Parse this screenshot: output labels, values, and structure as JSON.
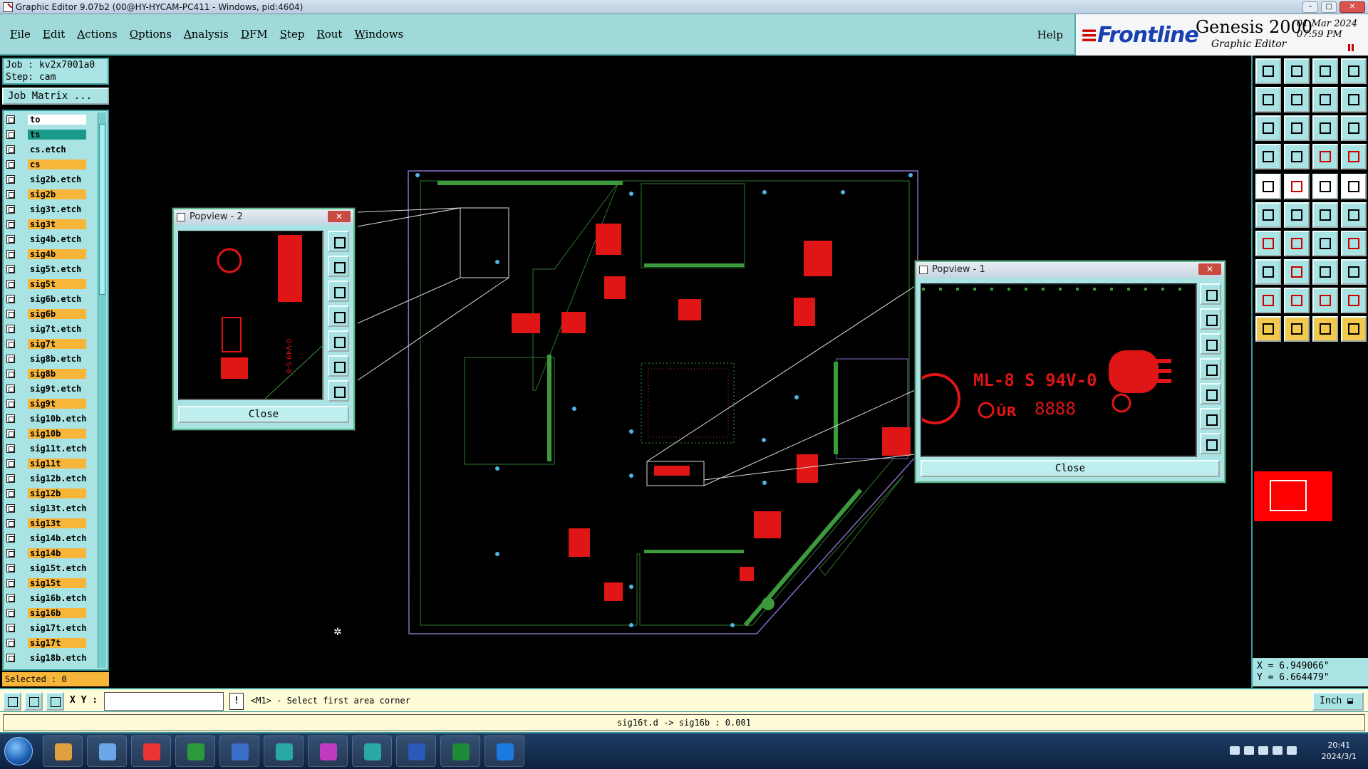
{
  "window": {
    "title": "Graphic Editor 9.07b2 (00@HY-HYCAM-PC411 - Windows, pid:4604)"
  },
  "menu": {
    "items": [
      "File",
      "Edit",
      "Actions",
      "Options",
      "Analysis",
      "DFM",
      "Step",
      "Rout",
      "Windows"
    ],
    "help": "Help"
  },
  "brand": {
    "logo": "Frontline",
    "product": "Genesis 2000",
    "subtitle": "Graphic Editor",
    "date": "01 Mar 2024",
    "time": "07:59 PM"
  },
  "job": {
    "job_line": "Job : kv2x7001a0",
    "step_line": "Step: cam",
    "matrix_button": "Job Matrix ..."
  },
  "layers": [
    {
      "name": "to",
      "color": "#ffffff"
    },
    {
      "name": "ts",
      "color": "#1a9a8a"
    },
    {
      "name": "cs.etch",
      "color": "#a9e3e3"
    },
    {
      "name": "cs",
      "color": "#f7b53a"
    },
    {
      "name": "sig2b.etch",
      "color": "#a9e3e3"
    },
    {
      "name": "sig2b",
      "color": "#f7b53a"
    },
    {
      "name": "sig3t.etch",
      "color": "#a9e3e3"
    },
    {
      "name": "sig3t",
      "color": "#f7b53a"
    },
    {
      "name": "sig4b.etch",
      "color": "#a9e3e3"
    },
    {
      "name": "sig4b",
      "color": "#f7b53a"
    },
    {
      "name": "sig5t.etch",
      "color": "#a9e3e3"
    },
    {
      "name": "sig5t",
      "color": "#f7b53a"
    },
    {
      "name": "sig6b.etch",
      "color": "#a9e3e3"
    },
    {
      "name": "sig6b",
      "color": "#f7b53a"
    },
    {
      "name": "sig7t.etch",
      "color": "#a9e3e3"
    },
    {
      "name": "sig7t",
      "color": "#f7b53a"
    },
    {
      "name": "sig8b.etch",
      "color": "#a9e3e3"
    },
    {
      "name": "sig8b",
      "color": "#f7b53a"
    },
    {
      "name": "sig9t.etch",
      "color": "#a9e3e3"
    },
    {
      "name": "sig9t",
      "color": "#f7b53a"
    },
    {
      "name": "sig10b.etch",
      "color": "#a9e3e3"
    },
    {
      "name": "sig10b",
      "color": "#f7b53a"
    },
    {
      "name": "sig11t.etch",
      "color": "#a9e3e3"
    },
    {
      "name": "sig11t",
      "color": "#f7b53a"
    },
    {
      "name": "sig12b.etch",
      "color": "#a9e3e3"
    },
    {
      "name": "sig12b",
      "color": "#f7b53a"
    },
    {
      "name": "sig13t.etch",
      "color": "#a9e3e3"
    },
    {
      "name": "sig13t",
      "color": "#f7b53a"
    },
    {
      "name": "sig14b.etch",
      "color": "#a9e3e3"
    },
    {
      "name": "sig14b",
      "color": "#f7b53a"
    },
    {
      "name": "sig15t.etch",
      "color": "#a9e3e3"
    },
    {
      "name": "sig15t",
      "color": "#f7b53a"
    },
    {
      "name": "sig16b.etch",
      "color": "#a9e3e3"
    },
    {
      "name": "sig16b",
      "color": "#f7b53a"
    },
    {
      "name": "sig17t.etch",
      "color": "#a9e3e3"
    },
    {
      "name": "sig17t",
      "color": "#f7b53a"
    },
    {
      "name": "sig18b.etch",
      "color": "#a9e3e3"
    }
  ],
  "selected": "Selected : 0",
  "popview2": {
    "title": "Popview - 2",
    "close_label": "Close",
    "close_x": "✕"
  },
  "popview1": {
    "title": "Popview - 1",
    "close_label": "Close",
    "close_x": "✕",
    "marking_text": "ML-8 S 94V-0",
    "datecode": "8888"
  },
  "coords": {
    "x": "X = 6.949066\"",
    "y": "Y = 6.664479\""
  },
  "command": {
    "xy_label": "X Y :",
    "xy_value": "",
    "prompt": "<M1> - Select first area corner",
    "units": "Inch"
  },
  "status": {
    "text": "sig16t.d -> sig16b : 0.001"
  },
  "taskbar": {
    "time": "20:41",
    "date": "2024/3/1"
  },
  "colors": {
    "panel": "#a9e3e3",
    "layer_active": "#f7b53a",
    "signal_red": "#ff0000",
    "signal_green": "#3c9a3c",
    "via_blue": "#4fb4e6"
  }
}
